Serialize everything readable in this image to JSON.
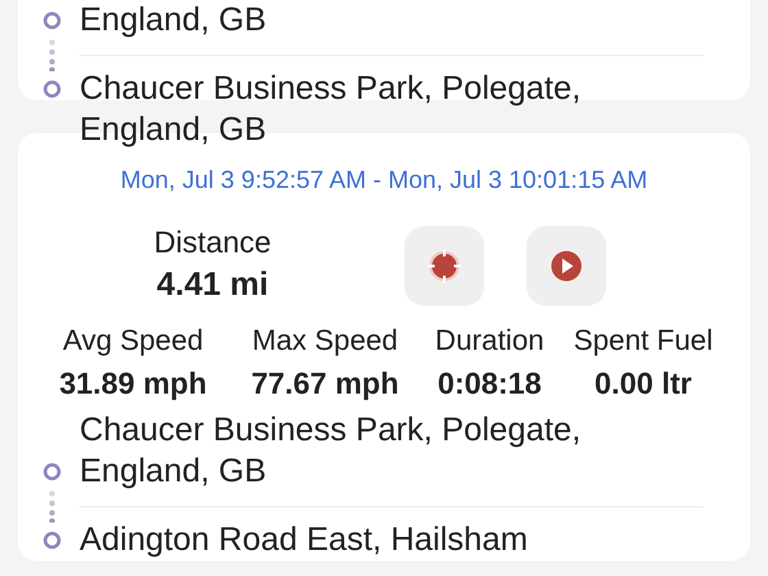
{
  "trips": [
    {
      "route": [
        {
          "address": "England, GB"
        },
        {
          "address": "Chaucer Business Park, Polegate, England, GB"
        }
      ]
    },
    {
      "period": "Mon, Jul 3 9:52:57 AM - Mon, Jul 3 10:01:15 AM",
      "distance": {
        "label": "Distance",
        "value": "4.41 mi"
      },
      "actions": [
        {
          "kind": "locate"
        },
        {
          "kind": "play"
        }
      ],
      "stats": [
        {
          "label": "Avg Speed",
          "value": "31.89 mph"
        },
        {
          "label": "Max Speed",
          "value": "77.67 mph"
        },
        {
          "label": "Duration",
          "value": "0:08:18"
        },
        {
          "label": "Spent Fuel",
          "value": "0.00 ltr"
        }
      ],
      "route": [
        {
          "address": "Chaucer Business Park, Polegate, England, GB"
        },
        {
          "address": "Adington Road East, Hailsham"
        }
      ]
    }
  ]
}
